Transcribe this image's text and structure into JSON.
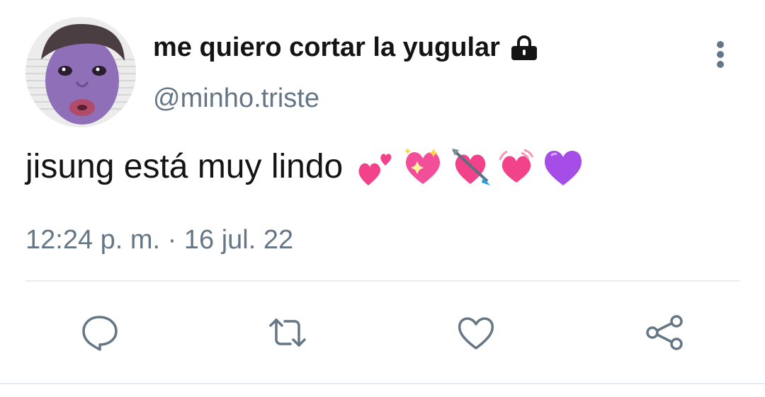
{
  "tweet": {
    "display_name": "me quiero cortar la yugular",
    "handle": "@minho.triste",
    "text": "jisung está muy lindo",
    "emojis": [
      "two-hearts",
      "sparkling-heart",
      "heart-with-arrow",
      "beating-heart",
      "purple-heart"
    ],
    "timestamp": "12:24 p. m. · 16 jul. 22",
    "account_locked": true
  },
  "icons": {
    "lock": "lock-icon",
    "more": "more-vertical-icon",
    "reply": "reply-bubble-icon",
    "retweet": "retweet-icon",
    "like": "heart-outline-icon",
    "share": "share-icon"
  },
  "colors": {
    "text": "#141414",
    "secondary": "#657786",
    "divider": "#e6ecf0",
    "emoji_pink": "#f2438a",
    "emoji_purple": "#a64de8"
  }
}
